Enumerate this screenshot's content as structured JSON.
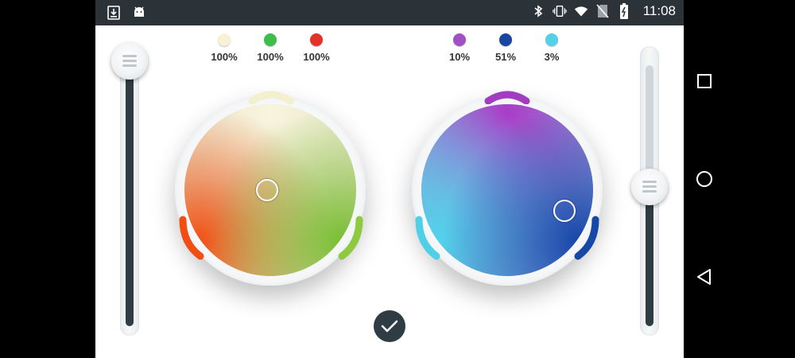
{
  "status_bar": {
    "time": "11:08",
    "left_icons": [
      "download-icon",
      "android-icon"
    ],
    "right_icons": [
      "bluetooth-icon",
      "vibrate-icon",
      "wifi-icon",
      "no-sim-icon",
      "battery-charging-icon"
    ]
  },
  "left_wheel": {
    "channels": [
      {
        "color": "#f7f1d6",
        "value": "100%"
      },
      {
        "color": "#3cbf4a",
        "value": "100%"
      },
      {
        "color": "#e2332a",
        "value": "100%"
      }
    ],
    "selector_color": "#ffffff",
    "arc_colors": {
      "top": "#f3efcf",
      "left": "#f04e14",
      "right": "#8fc93f"
    }
  },
  "right_wheel": {
    "channels": [
      {
        "color": "#a24fc2",
        "value": "10%"
      },
      {
        "color": "#1745a0",
        "value": "51%"
      },
      {
        "color": "#55d0e6",
        "value": "3%"
      }
    ],
    "arc_colors": {
      "top": "#a03dc0",
      "left": "#4fd0e8",
      "right": "#1648a6"
    }
  },
  "left_slider": {
    "level_percent": 100
  },
  "right_slider": {
    "level_percent": 50
  },
  "colors": {
    "dark": "#2f3c44",
    "status_bar": "#2b3338"
  },
  "nav_bar": {
    "icons": [
      "recent-apps-icon",
      "home-icon",
      "back-icon"
    ]
  },
  "confirm_icon": "checkmark-icon"
}
